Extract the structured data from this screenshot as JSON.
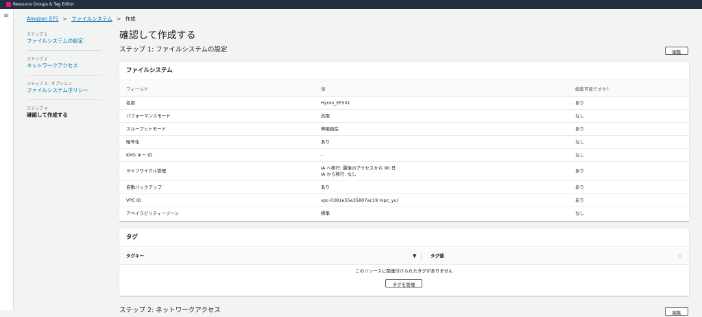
{
  "app": {
    "title": "Resource Groups & Tag Editor"
  },
  "breadcrumb": {
    "items": [
      "Amazon EFS",
      "ファイルシステム"
    ],
    "current": "作成",
    "separator": ">"
  },
  "steps": [
    {
      "num": "ステップ 1",
      "name": "ファイルシステムの設定"
    },
    {
      "num": "ステップ 2",
      "name": "ネットワークアクセス"
    },
    {
      "num": "ステップ 3 - オプション",
      "name": "ファイルシステムポリシー"
    },
    {
      "num": "ステップ 4",
      "name": "確認して作成する"
    }
  ],
  "page": {
    "title": "確認して作成する",
    "section_title": "ステップ 1: ファイルシステムの設定",
    "edit_label": "編集"
  },
  "filesystem": {
    "header": "ファイルシステム",
    "columns": [
      "フィールド",
      "値",
      "編集可能ですか?"
    ],
    "rows": [
      {
        "field": "名前",
        "value": "Hyron_EFS01",
        "value2": "",
        "editable": "あり"
      },
      {
        "field": "パフォーマンスモード",
        "value": "汎用",
        "value2": "",
        "editable": "なし"
      },
      {
        "field": "スループットモード",
        "value": "伸縮自在",
        "value2": "",
        "editable": "あり"
      },
      {
        "field": "暗号化",
        "value": "あり",
        "value2": "",
        "editable": "なし"
      },
      {
        "field": "KMS キー ID",
        "value": "-",
        "value2": "",
        "editable": "なし"
      },
      {
        "field": "ライフサイクル管理",
        "value": "IA へ移行: 最後のアクセスから 90 日",
        "value2": "IA から移行: なし",
        "editable": "あり"
      },
      {
        "field": "自動バックアップ",
        "value": "あり",
        "value2": "",
        "editable": "あり"
      },
      {
        "field": "VPC ID",
        "value": "vpc-0381e55e35807ac19 (vpc_yu)",
        "value2": "",
        "editable": "あり"
      },
      {
        "field": "アベイラビリティーゾーン",
        "value": "標準",
        "value2": "",
        "editable": "なし"
      }
    ]
  },
  "tags": {
    "header": "タグ",
    "col_key": "タグキー",
    "col_value": "タグ値",
    "sort_desc_glyph": "▼",
    "sort_none_glyph": "▽",
    "empty_message": "このリソースに関連付けられたタグがありません",
    "manage_label": "タグを管理"
  },
  "next_section": {
    "title": "ステップ 2: ネットワークアクセス",
    "edit_label": "編集"
  },
  "colors": {
    "link": "#0073bb",
    "topbar": "#232f3e",
    "brand": "#e7157b"
  }
}
